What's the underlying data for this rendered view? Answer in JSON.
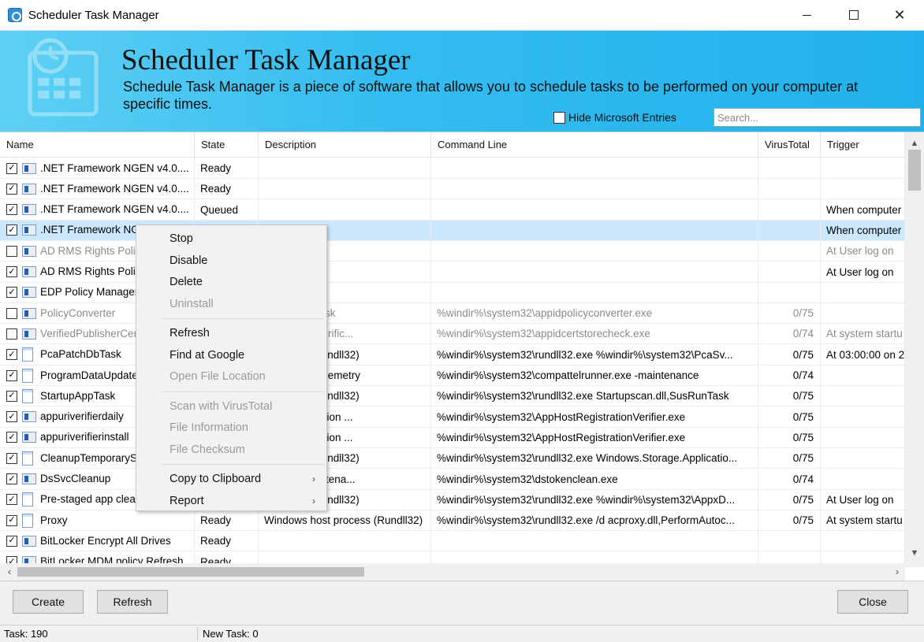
{
  "window": {
    "title": "Scheduler Task Manager",
    "controls": {
      "minimize": "minimize",
      "maximize": "maximize",
      "close": "✕"
    }
  },
  "banner": {
    "title": "Scheduler Task Manager",
    "description": "Schedule Task Manager is a piece of software that allows you to schedule tasks to be performed on your computer at specific times.",
    "hide_ms_label": "Hide Microsoft Entries",
    "hide_ms_checked": false,
    "search_placeholder": "Search..."
  },
  "columns": {
    "name": "Name",
    "state": "State",
    "description": "Description",
    "command": "Command Line",
    "virustotal": "VirusTotal",
    "trigger": "Trigger"
  },
  "rows": [
    {
      "checked": "✓",
      "icon": "task-icon",
      "name": ".NET Framework NGEN v4.0....",
      "state": "Ready",
      "description": "",
      "command": "",
      "vt": "",
      "trigger": "",
      "gray": false,
      "selected": false
    },
    {
      "checked": "✓",
      "icon": "task-icon",
      "name": ".NET Framework NGEN v4.0....",
      "state": "Ready",
      "description": "",
      "command": "",
      "vt": "",
      "trigger": "",
      "gray": false,
      "selected": false
    },
    {
      "checked": "✓",
      "icon": "task-icon",
      "name": ".NET Framework NGEN v4.0....",
      "state": "Queued",
      "description": "",
      "command": "",
      "vt": "",
      "trigger": "When computer i",
      "gray": false,
      "selected": false
    },
    {
      "checked": "✓",
      "icon": "task-icon",
      "name": ".NET Framework NGEN v4.0....",
      "state": "",
      "description": "",
      "command": "",
      "vt": "",
      "trigger": "When computer i",
      "gray": false,
      "selected": true
    },
    {
      "checked": "",
      "icon": "task-icon",
      "name": "AD RMS Rights Policy Template",
      "state": "",
      "description": "",
      "command": "",
      "vt": "",
      "trigger": "At User log on",
      "gray": true,
      "selected": false
    },
    {
      "checked": "✓",
      "icon": "task-icon",
      "name": "AD RMS Rights Policy Template",
      "state": "",
      "description": "",
      "command": "",
      "vt": "",
      "trigger": "At User log on",
      "gray": false,
      "selected": false
    },
    {
      "checked": "✓",
      "icon": "task-icon",
      "name": "EDP Policy Manager",
      "state": "",
      "description": "",
      "command": "",
      "vt": "",
      "trigger": "",
      "gray": false,
      "selected": false
    },
    {
      "checked": "",
      "icon": "task-icon",
      "name": "PolicyConverter",
      "state": "",
      "description": "Converter Task",
      "command": "%windir%\\system32\\appidpolicyconverter.exe",
      "vt": "0/75",
      "trigger": "",
      "gray": true,
      "selected": false
    },
    {
      "checked": "",
      "icon": "task-icon",
      "name": "VerifiedPublisherCertStoreCheck",
      "state": "",
      "description": "cate Store Verific...",
      "command": "%windir%\\system32\\appidcertstorecheck.exe",
      "vt": "0/74",
      "trigger": "At system startu",
      "gray": true,
      "selected": false
    },
    {
      "checked": "✓",
      "icon": "doc-icon",
      "name": "PcaPatchDbTask",
      "state": "",
      "description": "t process (Rundll32)",
      "command": "%windir%\\system32\\rundll32.exe %windir%\\system32\\PcaSv...",
      "vt": "0/75",
      "trigger": "At 03:00:00 on 2",
      "gray": false,
      "selected": false
    },
    {
      "checked": "✓",
      "icon": "doc-icon",
      "name": "ProgramDataUpdater",
      "state": "",
      "description": "mpatibility Telemetry",
      "command": "%windir%\\system32\\compattelrunner.exe -maintenance",
      "vt": "0/74",
      "trigger": "",
      "gray": false,
      "selected": false
    },
    {
      "checked": "✓",
      "icon": "doc-icon",
      "name": "StartupAppTask",
      "state": "",
      "description": "t process (Rundll32)",
      "command": "%windir%\\system32\\rundll32.exe Startupscan.dll,SusRunTask",
      "vt": "0/75",
      "trigger": "",
      "gray": false,
      "selected": false
    },
    {
      "checked": "✓",
      "icon": "task-icon",
      "name": "appuriverifierdaily",
      "state": "",
      "description": "lers Registration ...",
      "command": "%windir%\\system32\\AppHostRegistrationVerifier.exe",
      "vt": "0/75",
      "trigger": "",
      "gray": false,
      "selected": false
    },
    {
      "checked": "✓",
      "icon": "task-icon",
      "name": "appuriverifierinstall",
      "state": "",
      "description": "lers Registration ...",
      "command": "%windir%\\system32\\AppHostRegistrationVerifier.exe",
      "vt": "0/75",
      "trigger": "",
      "gray": false,
      "selected": false
    },
    {
      "checked": "✓",
      "icon": "doc-icon",
      "name": "CleanupTemporaryState",
      "state": "",
      "description": "t process (Rundll32)",
      "command": "%windir%\\system32\\rundll32.exe Windows.Storage.Applicatio...",
      "vt": "0/75",
      "trigger": "",
      "gray": false,
      "selected": false
    },
    {
      "checked": "✓",
      "icon": "task-icon",
      "name": "DsSvcCleanup",
      "state": "",
      "description": "Service Maintena...",
      "command": "%windir%\\system32\\dstokenclean.exe",
      "vt": "0/74",
      "trigger": "",
      "gray": false,
      "selected": false
    },
    {
      "checked": "✓",
      "icon": "doc-icon",
      "name": "Pre-staged app cleanup",
      "state": "",
      "description": "t process (Rundll32)",
      "command": "%windir%\\system32\\rundll32.exe %windir%\\system32\\AppxD...",
      "vt": "0/75",
      "trigger": "At User log on",
      "gray": false,
      "selected": false
    },
    {
      "checked": "✓",
      "icon": "doc-icon",
      "name": "Proxy",
      "state": "Ready",
      "description": "Windows host process (Rundll32)",
      "command": "%windir%\\system32\\rundll32.exe /d acproxy.dll,PerformAutoc...",
      "vt": "0/75",
      "trigger": "At system startu",
      "gray": false,
      "selected": false
    },
    {
      "checked": "✓",
      "icon": "task-icon",
      "name": "BitLocker Encrypt All Drives",
      "state": "Ready",
      "description": "",
      "command": "",
      "vt": "",
      "trigger": "",
      "gray": false,
      "selected": false
    },
    {
      "checked": "✓",
      "icon": "task-icon",
      "name": "BitLocker MDM policy Refresh",
      "state": "Ready",
      "description": "",
      "command": "",
      "vt": "",
      "trigger": "",
      "gray": false,
      "selected": false
    }
  ],
  "context_menu": {
    "items": [
      {
        "label": "Stop",
        "enabled": true,
        "submenu": false
      },
      {
        "label": "Disable",
        "enabled": true,
        "submenu": false
      },
      {
        "label": "Delete",
        "enabled": true,
        "submenu": false
      },
      {
        "label": "Uninstall",
        "enabled": false,
        "submenu": false
      },
      {
        "separator": true
      },
      {
        "label": "Refresh",
        "enabled": true,
        "submenu": false
      },
      {
        "label": "Find at Google",
        "enabled": true,
        "submenu": false
      },
      {
        "label": "Open File Location",
        "enabled": false,
        "submenu": false
      },
      {
        "separator": true
      },
      {
        "label": "Scan with VirusTotal",
        "enabled": false,
        "submenu": false
      },
      {
        "label": "File Information",
        "enabled": false,
        "submenu": false
      },
      {
        "label": "File Checksum",
        "enabled": false,
        "submenu": false
      },
      {
        "separator": true
      },
      {
        "label": "Copy to Clipboard",
        "enabled": true,
        "submenu": true
      },
      {
        "label": "Report",
        "enabled": true,
        "submenu": true
      }
    ]
  },
  "buttons": {
    "create": "Create",
    "refresh": "Refresh",
    "close": "Close"
  },
  "status": {
    "task_count": "Task: 190",
    "new_task": "New Task: 0"
  }
}
